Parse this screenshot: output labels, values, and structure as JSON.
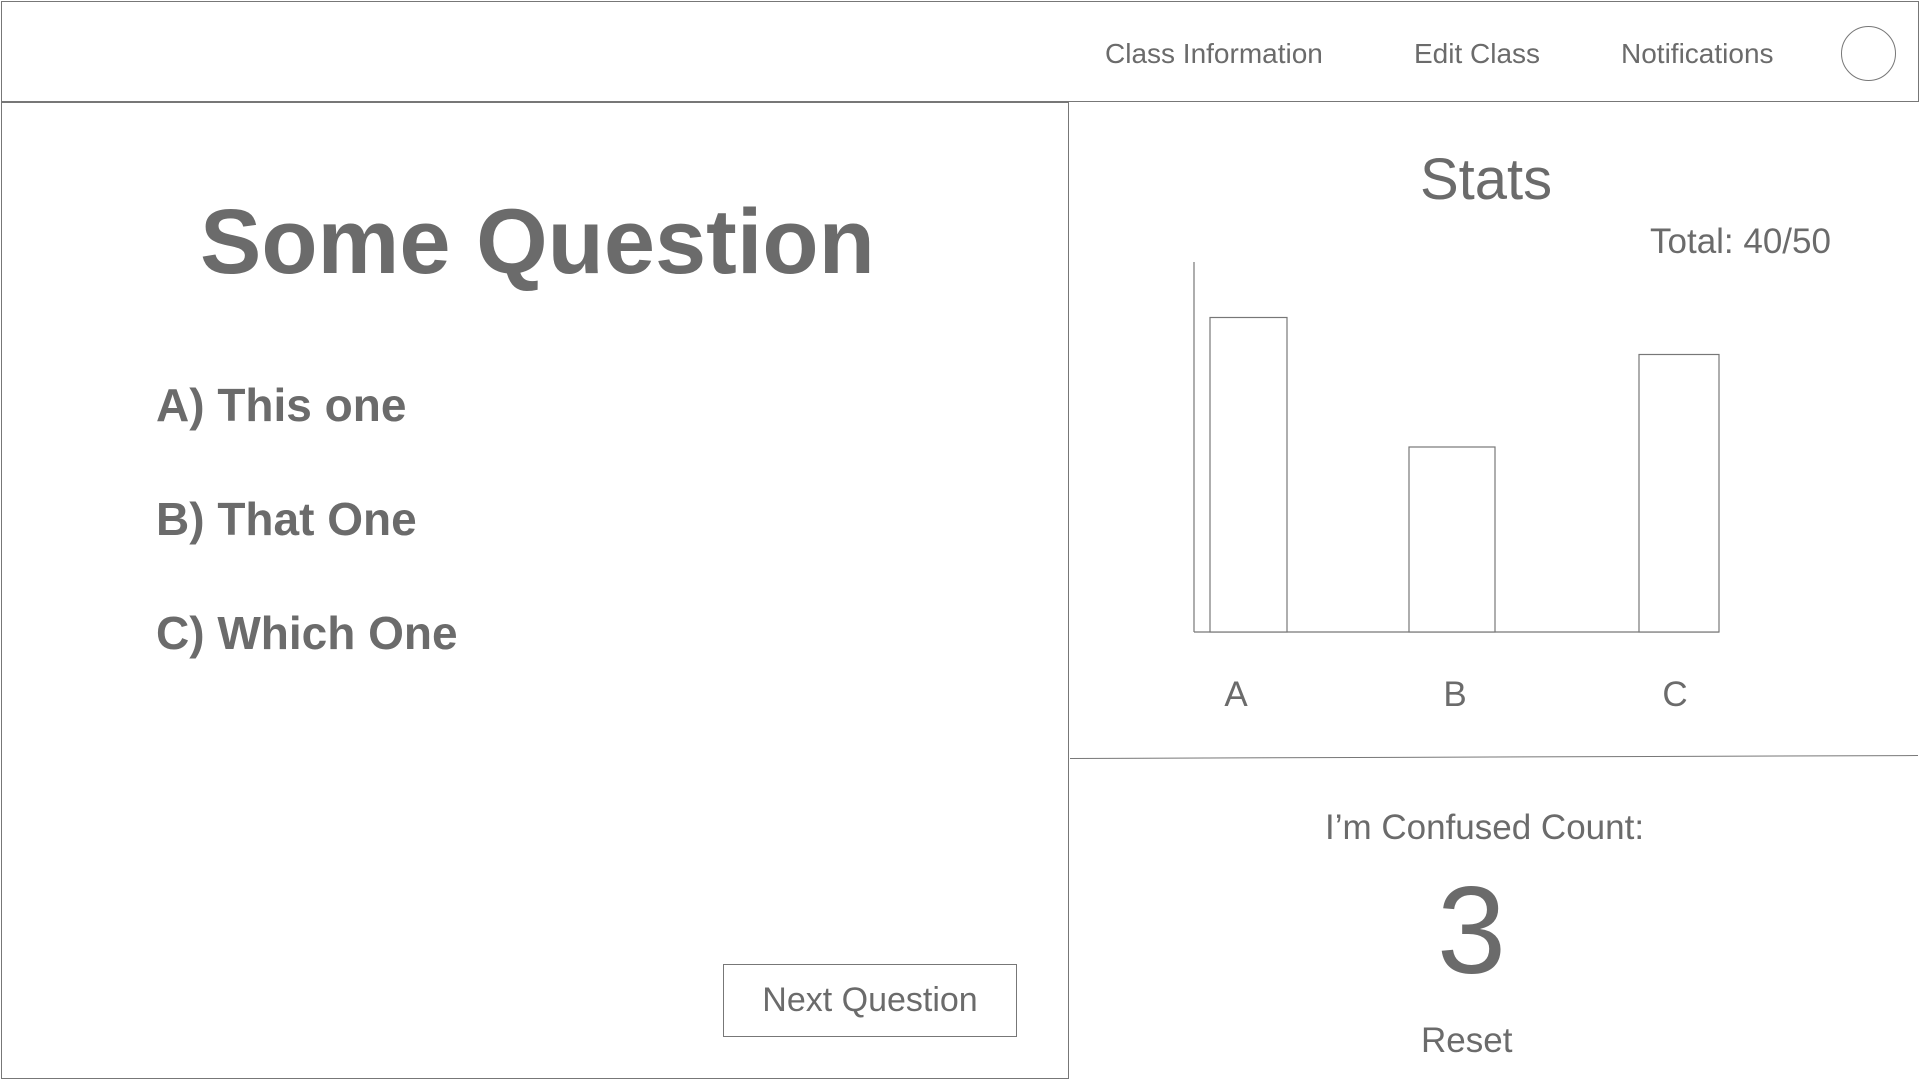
{
  "header": {
    "nav": [
      {
        "label": "Class Information"
      },
      {
        "label": "Edit Class"
      },
      {
        "label": "Notifications"
      }
    ]
  },
  "question": {
    "title": "Some Question",
    "options": [
      {
        "label": "A) This one"
      },
      {
        "label": "B) That One"
      },
      {
        "label": "C) Which One"
      }
    ],
    "next_label": "Next Question"
  },
  "stats": {
    "title": "Stats",
    "total_label": "Total: 40/50"
  },
  "chart_data": {
    "type": "bar",
    "categories": [
      "A",
      "B",
      "C"
    ],
    "values": [
      17,
      10,
      15
    ],
    "ylim": [
      0,
      20
    ],
    "title": "",
    "xlabel": "",
    "ylabel": "",
    "grid": false
  },
  "confused": {
    "label": "I’m Confused Count:",
    "count": "3",
    "reset_label": "Reset"
  },
  "colors": {
    "text": "#6b6b6b",
    "line": "#777777",
    "background": "#ffffff"
  }
}
